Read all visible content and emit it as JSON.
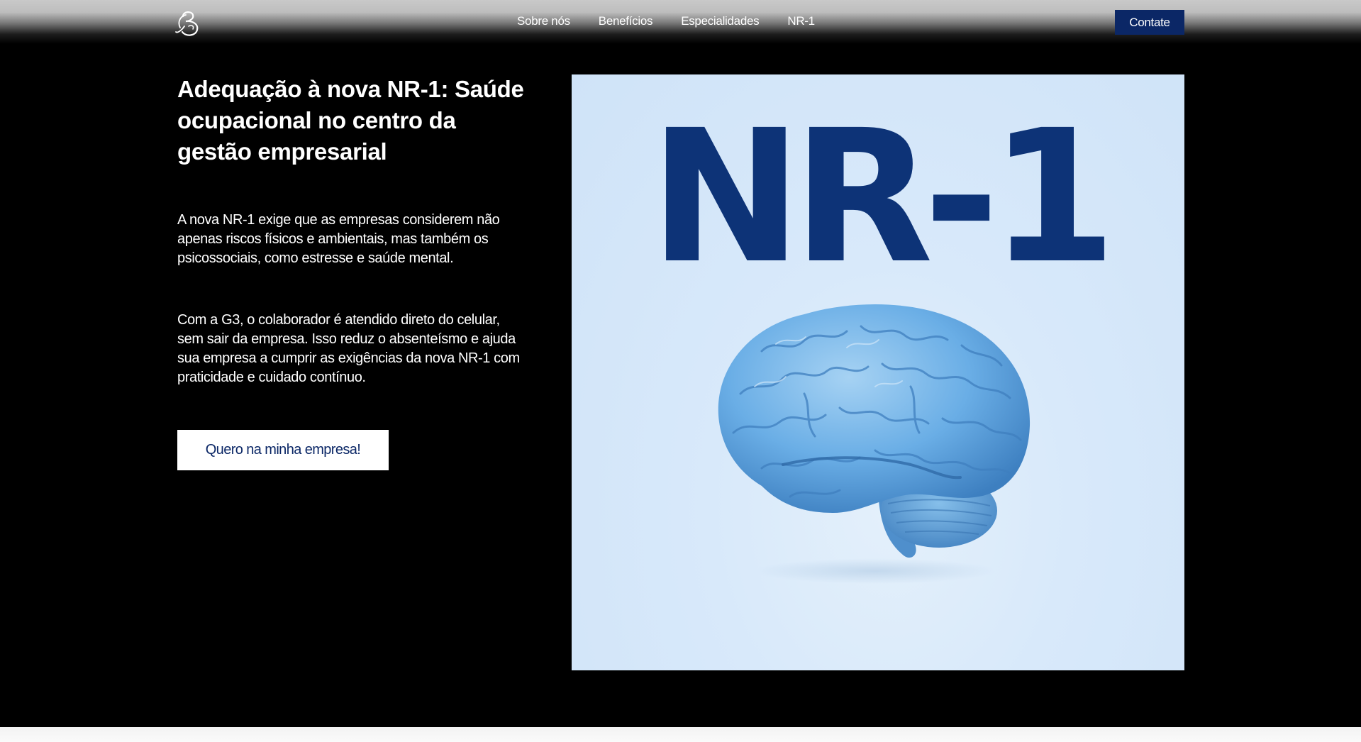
{
  "header": {
    "logo_icon": "g3-logo-icon",
    "nav": [
      {
        "label": "Sobre nós"
      },
      {
        "label": "Benefícios"
      },
      {
        "label": "Especialidades"
      },
      {
        "label": "NR-1"
      }
    ],
    "contact_label": "Contate"
  },
  "hero": {
    "title": "Adequação à nova NR-1: Saúde ocupacional no centro da gestão empresarial",
    "paragraph_1": "A nova NR-1 exige que as empresas considerem não apenas riscos físicos e ambientais, mas também os psicossociais, como estresse e saúde mental.",
    "paragraph_2": "Com a G3, o colaborador é atendido direto do celular, sem sair da empresa. Isso reduz o absenteísmo e ajuda sua empresa a cumprir as exigências da nova NR-1 com praticidade e cuidado contínuo.",
    "cta_label": "Quero na minha empresa!",
    "image": {
      "headline": "NR-1",
      "illustration": "brain-icon"
    }
  },
  "colors": {
    "background": "#000000",
    "accent": "#0b2766",
    "image_text": "#0d3377",
    "image_background": "#d3e6f9",
    "brain": "#6aaee6"
  }
}
